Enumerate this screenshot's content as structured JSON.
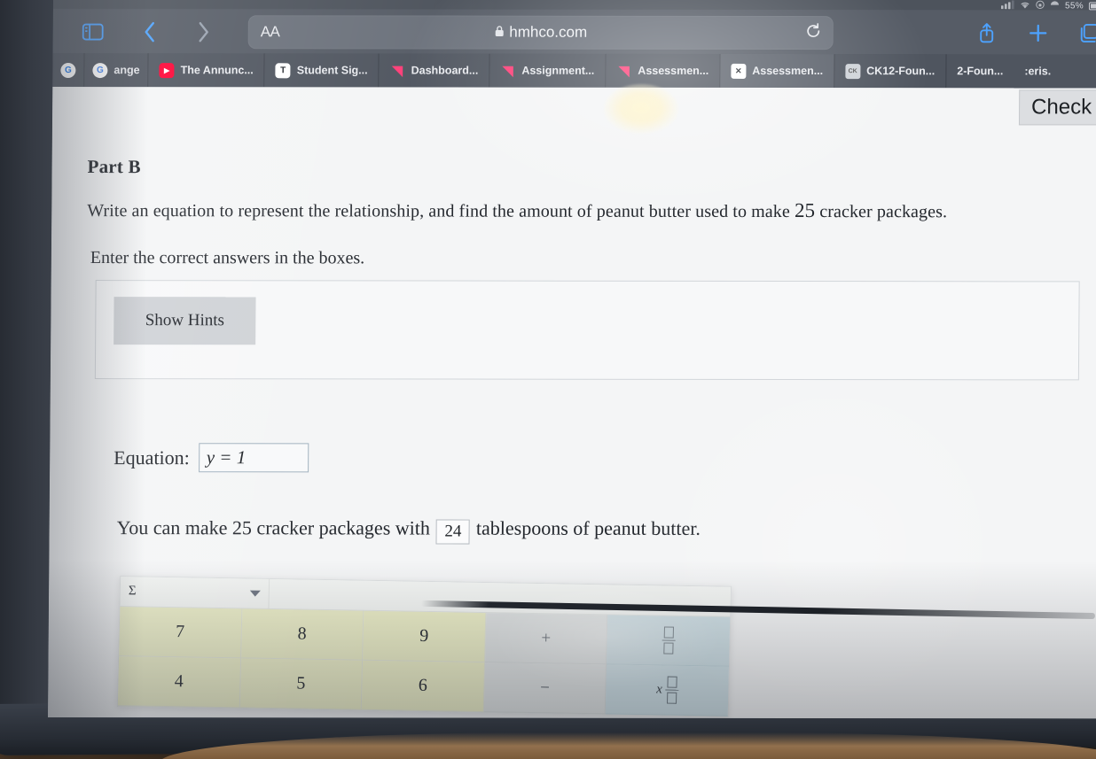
{
  "status_bar": {
    "signal_icon": "cellular-signal-icon",
    "wifi_icon": "wifi-icon",
    "rotation_lock_icon": "rotation-lock-icon",
    "charging_icon": "charging-icon",
    "battery_percent": "55%"
  },
  "browser": {
    "sidebar_icon": "sidebar-toggle-icon",
    "back_icon": "back-chevron-icon",
    "forward_icon": "forward-chevron-icon",
    "text_size_label": "AA",
    "lock_icon": "lock-icon",
    "url": "hmhco.com",
    "reload_icon": "reload-icon",
    "share_icon": "share-icon",
    "new_tab_icon": "plus-icon",
    "tabs_overview_icon": "tabs-overview-icon",
    "tabs": [
      {
        "favicon": "chrome-icon",
        "label": ""
      },
      {
        "favicon": "google-icon",
        "label": "ange"
      },
      {
        "favicon": "youtube-icon",
        "label": "The Annunc..."
      },
      {
        "favicon": "t-icon",
        "label": "Student Sig..."
      },
      {
        "favicon": "hmh-icon",
        "label": "Dashboard..."
      },
      {
        "favicon": "hmh-icon",
        "label": "Assignment..."
      },
      {
        "favicon": "hmh-icon",
        "label": "Assessmen..."
      },
      {
        "favicon": "x-icon",
        "label": "Assessmen..."
      },
      {
        "favicon": "ck12-icon",
        "label": "CK12-Foun..."
      },
      {
        "favicon": "",
        "label": "2-Foun..."
      },
      {
        "favicon": "",
        "label": ":eris."
      }
    ]
  },
  "page": {
    "check_button": "Check",
    "part_title": "Part B",
    "prompt_line_1_a": "Write an equation to represent the relationship, and find the amount of peanut butter used to make ",
    "prompt_line_1_num": "25",
    "prompt_line_1_b": " cracker packages.",
    "prompt_line_2": "Enter the correct answers in the boxes.",
    "show_hints_button": "Show Hints",
    "equation_label": "Equation:",
    "equation_value": "y = 1",
    "answer_sentence_before": "You can make 25 cracker packages with",
    "answer_value": "24",
    "answer_sentence_after": "tablespoons of peanut butter."
  },
  "keypad": {
    "mode_symbol": "Σ",
    "dropdown_icon": "chevron-down-icon",
    "keys": [
      {
        "label": "7",
        "type": "num"
      },
      {
        "label": "8",
        "type": "num"
      },
      {
        "label": "9",
        "type": "num"
      },
      {
        "label": "+",
        "type": "op"
      },
      {
        "label": "fraction-template",
        "type": "tpl"
      },
      {
        "label": "4",
        "type": "num"
      },
      {
        "label": "5",
        "type": "num"
      },
      {
        "label": "6",
        "type": "num"
      },
      {
        "label": "−",
        "type": "op"
      },
      {
        "label": "mixed-number-template",
        "type": "tpl"
      }
    ]
  },
  "colors": {
    "accent_blue": "#4da2ff",
    "keypad_number": "#edefc9",
    "keypad_operator": "#e0e3e3",
    "keypad_template": "#cfe0e6",
    "hmh_pink": "#ff3d77"
  }
}
